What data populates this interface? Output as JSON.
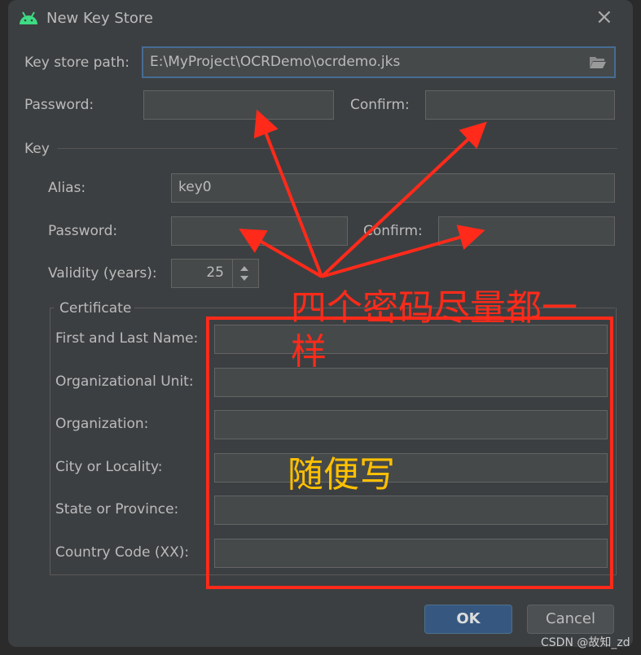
{
  "dialog": {
    "title": "New Key Store",
    "close": "×"
  },
  "keystore": {
    "path_label": "Key store path:",
    "path_value": "E:\\MyProject\\OCRDemo\\ocrdemo.jks",
    "password_label": "Password:",
    "confirm_label": "Confirm:"
  },
  "key": {
    "section": "Key",
    "alias_label": "Alias:",
    "alias_value": "key0",
    "password_label": "Password:",
    "confirm_label": "Confirm:",
    "validity_label": "Validity (years):",
    "validity_value": "25"
  },
  "certificate": {
    "section": "Certificate",
    "fields": [
      {
        "label": "First and Last Name:"
      },
      {
        "label": "Organizational Unit:"
      },
      {
        "label": "Organization:"
      },
      {
        "label": "City or Locality:"
      },
      {
        "label": "State or Province:"
      },
      {
        "label": "Country Code (XX):"
      }
    ]
  },
  "buttons": {
    "ok": "OK",
    "cancel": "Cancel"
  },
  "annotations": {
    "red_text": "四个密码尽量都一样",
    "yellow_text": "随便写",
    "red_color": "#ff2a1a",
    "yellow_color": "#ffc000"
  },
  "watermark": "CSDN @故知_zd"
}
